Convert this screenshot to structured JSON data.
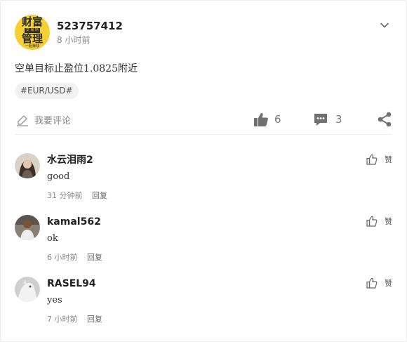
{
  "post": {
    "username": "523757412",
    "time": "8 小时前",
    "avatar_lines": [
      "财富",
      "交 易 所",
      "管理",
      "一起赚钱"
    ],
    "text": "空单目标止盈位1.0825附近",
    "tag": "#EUR/USD#"
  },
  "actions": {
    "comment_label": "我要评论",
    "like_count": "6",
    "comment_count": "3"
  },
  "comments": [
    {
      "name": "水云泪雨2",
      "text": "good",
      "time": "31 分钟前",
      "reply": "回复",
      "like": "赞"
    },
    {
      "name": "kamal562",
      "text": "ok",
      "time": "6 小时前",
      "reply": "回复",
      "like": "赞"
    },
    {
      "name": "RASEL94",
      "text": "yes",
      "time": "7 小时前",
      "reply": "回复",
      "like": "赞"
    }
  ],
  "colors": {
    "avatar_bg": "#f6d033",
    "muted": "#888888"
  },
  "icons": [
    "chevron-down-icon",
    "comment-edit-icon",
    "thumbs-up-icon",
    "message-icon",
    "share-icon"
  ]
}
